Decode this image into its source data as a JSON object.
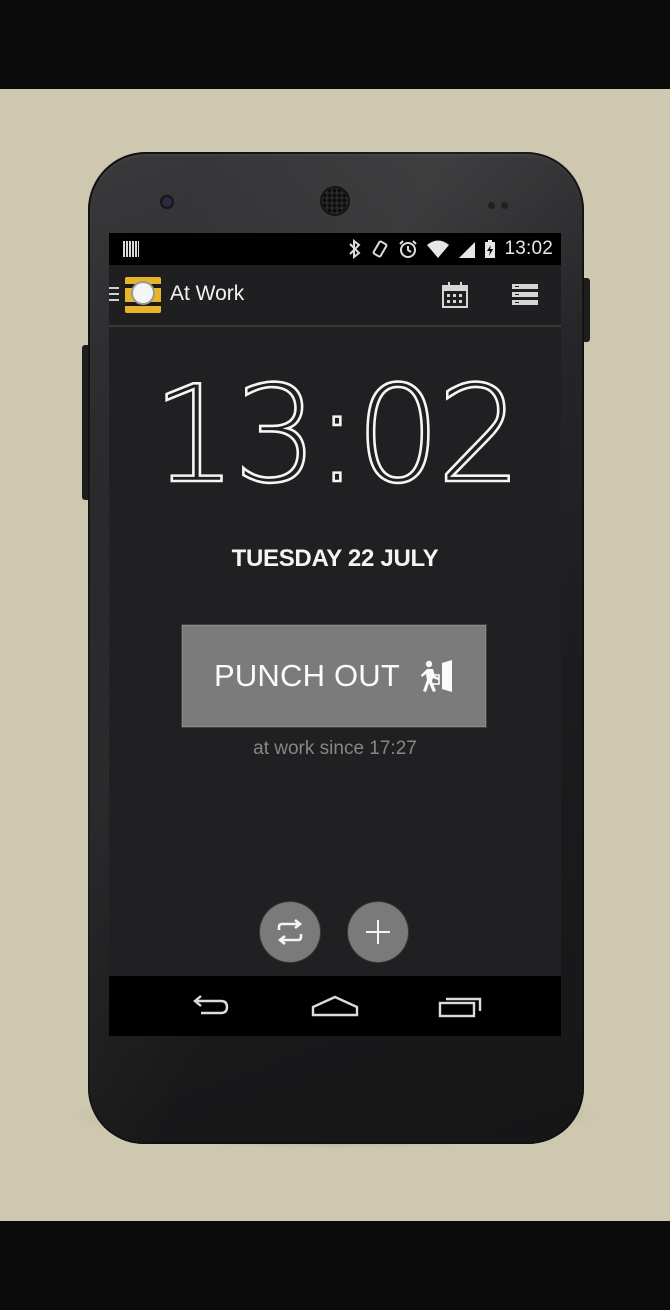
{
  "status_bar": {
    "time": "13:02",
    "icons": [
      "barcode-icon",
      "bluetooth-icon",
      "vibrate-icon",
      "alarm-icon",
      "wifi-icon",
      "signal-icon",
      "battery-charging-icon"
    ]
  },
  "action_bar": {
    "title": "At Work",
    "actions": [
      "calendar-icon",
      "list-icon"
    ]
  },
  "main": {
    "clock_hours": "13",
    "clock_colon": ":",
    "clock_minutes": "02",
    "date": "TUESDAY 22 JULY",
    "punch_button_label": "PUNCH OUT",
    "since_text": "at work since 17:27"
  },
  "fabs": [
    "switch-icon",
    "add-icon"
  ],
  "nav_bar": [
    "back-icon",
    "home-icon",
    "recents-icon"
  ],
  "colors": {
    "backdrop": "#cfc8b1",
    "screen_bg": "#202022",
    "button_gray": "#7b7b7b",
    "app_icon_yellow": "#e8b429"
  }
}
